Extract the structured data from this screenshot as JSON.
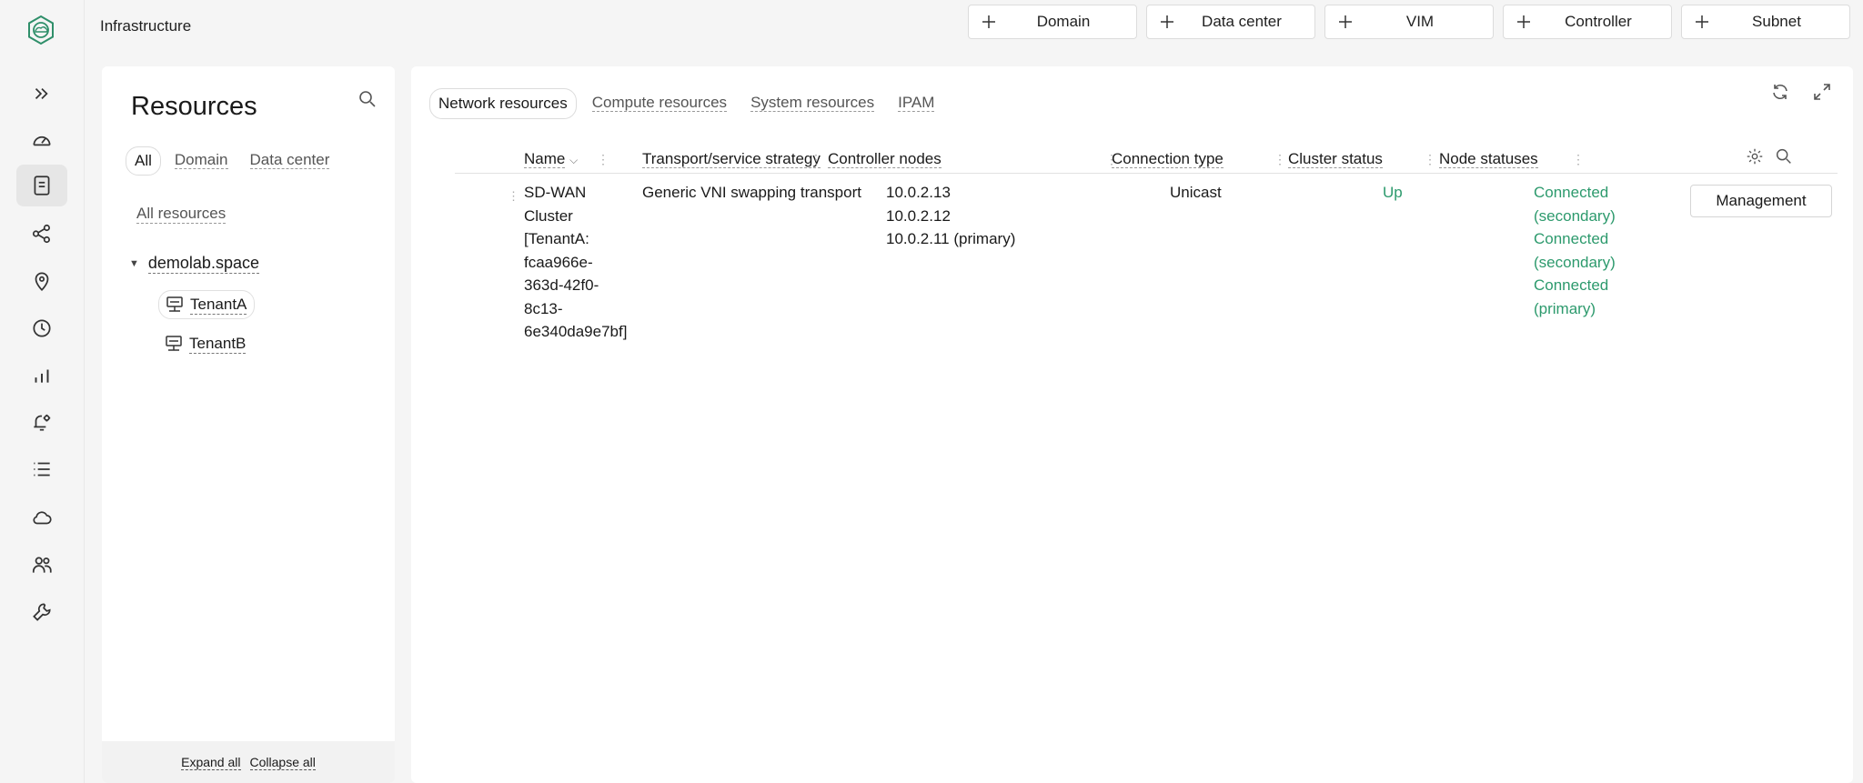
{
  "app": {
    "title": "Infrastructure"
  },
  "rail": {
    "items": [
      {
        "icon": "expand-icon"
      },
      {
        "icon": "dashboard-gauge-icon"
      },
      {
        "icon": "resources-document-icon",
        "active": true
      },
      {
        "icon": "share-nodes-icon"
      },
      {
        "icon": "location-pin-icon"
      },
      {
        "icon": "clock-icon"
      },
      {
        "icon": "bar-chart-icon"
      },
      {
        "icon": "bell-settings-icon"
      },
      {
        "icon": "list-icon"
      },
      {
        "icon": "cloud-icon"
      },
      {
        "icon": "users-icon"
      },
      {
        "icon": "wrench-icon"
      }
    ]
  },
  "toolbar": {
    "buttons": [
      {
        "label": "Domain"
      },
      {
        "label": "Data center"
      },
      {
        "label": "VIM"
      },
      {
        "label": "Controller"
      },
      {
        "label": "Subnet"
      }
    ]
  },
  "resources": {
    "title": "Resources",
    "tabs": [
      "All",
      "Domain",
      "Data center"
    ],
    "all_resources": "All resources",
    "tree": {
      "root": "demolab.space",
      "children": [
        "TenantA",
        "TenantB"
      ]
    },
    "expand_all": "Expand all",
    "collapse_all": "Collapse all"
  },
  "main": {
    "tabs": [
      "Network resources",
      "Compute resources",
      "System resources",
      "IPAM"
    ],
    "columns": [
      "Name",
      "Transport/service strategy",
      "Controller nodes",
      "Connection type",
      "Cluster status",
      "Node statuses"
    ],
    "rows": [
      {
        "name": "SD-WAN\nCluster\n[TenantA:\nfcaa966e-\n363d-42f0-\n8c13-\n6e340da9e7bf]",
        "strategy": "Generic VNI swapping transport",
        "controllers": "10.0.2.13\n10.0.2.12\n10.0.2.11 (primary)",
        "connection": "Unicast",
        "status": "Up",
        "nodes": "Connected\n(secondary)\nConnected\n(secondary)\nConnected\n(primary)",
        "action": "Management"
      }
    ]
  },
  "colors": {
    "status_green": "#2d9a6d",
    "logo_green": "#2f8f6a"
  }
}
